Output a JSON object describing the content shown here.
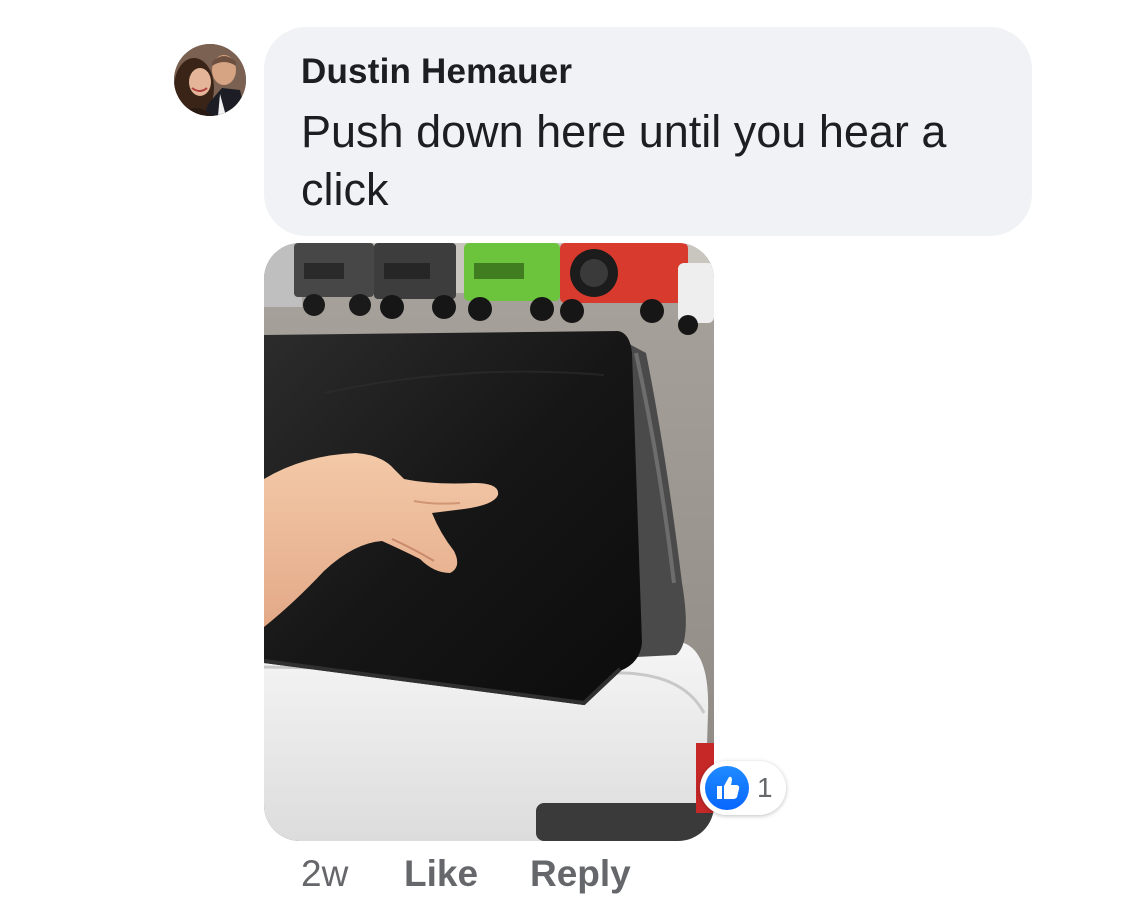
{
  "comment": {
    "author": "Dustin Hemauer",
    "text": "Push down here until you hear a click",
    "timestamp": "2w",
    "actions": {
      "like": "Like",
      "reply": "Reply"
    },
    "reactions": {
      "type": "like-icon",
      "count": "1"
    }
  },
  "colors": {
    "bubble": "#f0f2f5",
    "meta_text": "#65676b",
    "like_blue": "#1877f2"
  }
}
